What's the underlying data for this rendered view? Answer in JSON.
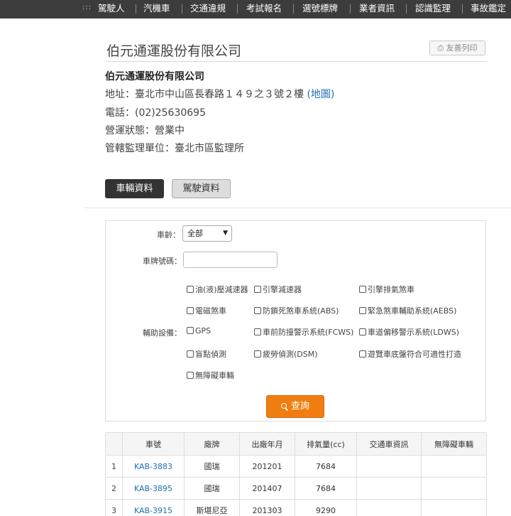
{
  "nav": {
    "items": [
      "駕駛人",
      "汽機車",
      "交通違規",
      "考試報名",
      "選號標牌",
      "業者資訊",
      "認識監理",
      "事故鑑定"
    ]
  },
  "company": {
    "title": "伯元通運股份有限公司",
    "name": "伯元通運股份有限公司",
    "address_label": "地址：",
    "address": "臺北市中山區長春路１４９之３號２樓",
    "map_link": "(地圖)",
    "phone_label": "電話：",
    "phone": "(02)25630695",
    "status_label": "營運狀態：",
    "status": "營業中",
    "office_label": "管轄監理單位：",
    "office": "臺北市區監理所"
  },
  "print_button": "友善列印",
  "tabs": [
    "車輛資料",
    "駕駛資料"
  ],
  "filters": {
    "age_label": "車齡：",
    "age_value": "全部",
    "plate_label": "車牌號碼：",
    "plate_value": "",
    "equipment_label": "輔助設備：",
    "equipment_options": [
      "油(液)壓減速器",
      "引擎減速器",
      "引擎排氣煞車",
      "電磁煞車",
      "防鎖死煞車系統(ABS)",
      "緊急煞車輔助系統(AEBS)",
      "GPS",
      "車前防撞警示系統(FCWS)",
      "車道偏移警示系統(LDWS)",
      "盲點偵測",
      "疲勞偵測(DSM)",
      "遊覽車底盤符合可適性打造",
      "無障礙車輛"
    ],
    "search_button": "查詢"
  },
  "table": {
    "headers": [
      "",
      "車號",
      "廠牌",
      "出廠年月",
      "排氣量(cc)",
      "交通車資訊",
      "無障礙車輛"
    ],
    "rows": [
      [
        "1",
        "KAB-3883",
        "國瑞",
        "201201",
        "7684",
        "",
        ""
      ],
      [
        "2",
        "KAB-3895",
        "國瑞",
        "201407",
        "7684",
        "",
        ""
      ],
      [
        "3",
        "KAB-3915",
        "斯堪尼亞",
        "201303",
        "9290",
        "",
        ""
      ]
    ]
  },
  "colors": {
    "nav_bg": "#3c3c3c",
    "link": "#1f6fb2",
    "search_button": "#f07d10",
    "active_tab": "#333333"
  }
}
